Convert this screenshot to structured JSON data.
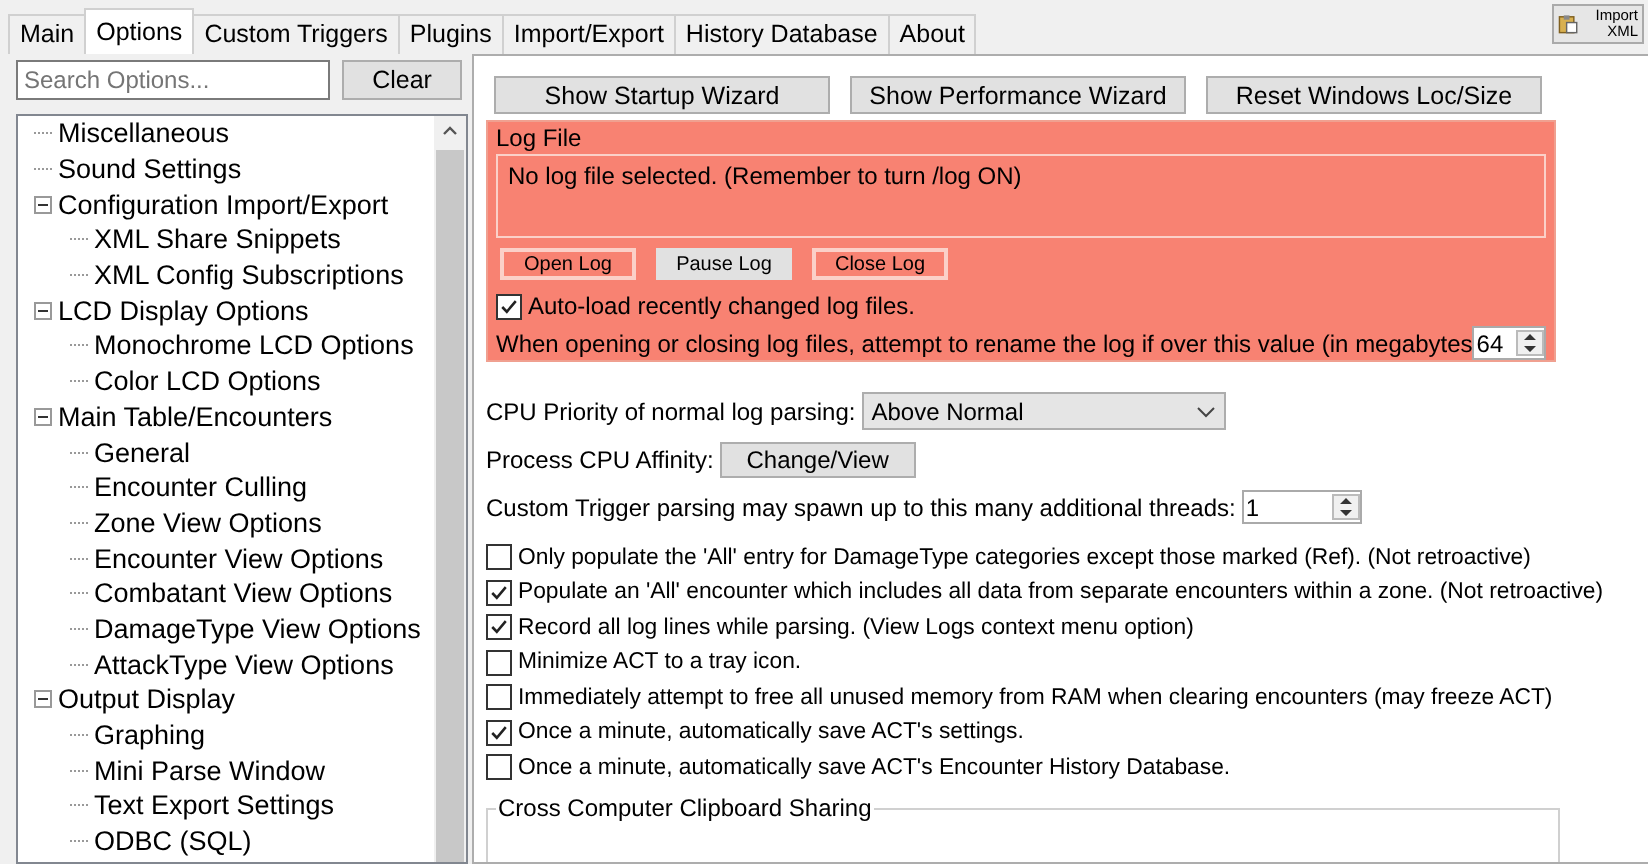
{
  "tabs": [
    {
      "label": "Main",
      "selected": false
    },
    {
      "label": "Options",
      "selected": true
    },
    {
      "label": "Custom Triggers",
      "selected": false
    },
    {
      "label": "Plugins",
      "selected": false
    },
    {
      "label": "Import/Export",
      "selected": false
    },
    {
      "label": "History Database",
      "selected": false
    },
    {
      "label": "About",
      "selected": false
    }
  ],
  "import_button": {
    "label": "Import XML"
  },
  "search": {
    "placeholder": "Search Options...",
    "clear_label": "Clear"
  },
  "tree": [
    {
      "label": "Miscellaneous"
    },
    {
      "label": "Sound Settings"
    },
    {
      "label": "Configuration Import/Export",
      "expanded": true,
      "children": [
        {
          "label": "XML Share Snippets"
        },
        {
          "label": "XML Config Subscriptions"
        }
      ]
    },
    {
      "label": "LCD Display Options",
      "expanded": true,
      "children": [
        {
          "label": "Monochrome LCD Options"
        },
        {
          "label": "Color LCD Options"
        }
      ]
    },
    {
      "label": "Main Table/Encounters",
      "expanded": true,
      "children": [
        {
          "label": "General"
        },
        {
          "label": "Encounter Culling"
        },
        {
          "label": "Zone View Options"
        },
        {
          "label": "Encounter View Options"
        },
        {
          "label": "Combatant View Options"
        },
        {
          "label": "DamageType View Options"
        },
        {
          "label": "AttackType View Options"
        }
      ]
    },
    {
      "label": "Output Display",
      "expanded": true,
      "children": [
        {
          "label": "Graphing"
        },
        {
          "label": "Mini Parse Window"
        },
        {
          "label": "Text Export Settings"
        },
        {
          "label": "ODBC (SQL)"
        }
      ]
    }
  ],
  "top_buttons": [
    "Show Startup Wizard",
    "Show Performance Wizard",
    "Reset Windows Loc/Size"
  ],
  "log_file": {
    "title": "Log File",
    "status": "No log file selected. (Remember to turn /log ON)",
    "buttons": [
      {
        "label": "Open Log",
        "disabled": false
      },
      {
        "label": "Pause Log",
        "disabled": true
      },
      {
        "label": "Close Log",
        "disabled": false
      }
    ],
    "auto_load": {
      "label": "Auto-load recently changed log files.",
      "checked": true
    },
    "rename_label": "When opening or closing log files, attempt to rename the log if over this value (in megabytes",
    "rename_value": "64"
  },
  "cpu_priority": {
    "label": "CPU Priority of normal log parsing:",
    "value": "Above Normal"
  },
  "affinity": {
    "label": "Process CPU Affinity:",
    "button": "Change/View"
  },
  "threads": {
    "label": "Custom Trigger parsing may spawn up to this many additional threads:",
    "value": "1"
  },
  "options": [
    {
      "label": "Only populate the 'All' entry for DamageType categories except those marked (Ref). (Not retroactive)",
      "checked": false
    },
    {
      "label": "Populate an 'All' encounter which includes all data from separate encounters within a zone. (Not retroactive)",
      "checked": true
    },
    {
      "label": "Record all log lines while parsing. (View Logs context menu option)",
      "checked": true
    },
    {
      "label": "Minimize ACT to a tray icon.",
      "checked": false
    },
    {
      "label": "Immediately attempt to free all unused memory from RAM when clearing encounters (may freeze ACT)",
      "checked": false
    },
    {
      "label": "Once a minute, automatically save ACT's settings.",
      "checked": true
    },
    {
      "label": "Once a minute, automatically save ACT's Encounter History Database.",
      "checked": false
    }
  ],
  "clipboard_group": {
    "title": "Cross Computer Clipboard Sharing"
  }
}
